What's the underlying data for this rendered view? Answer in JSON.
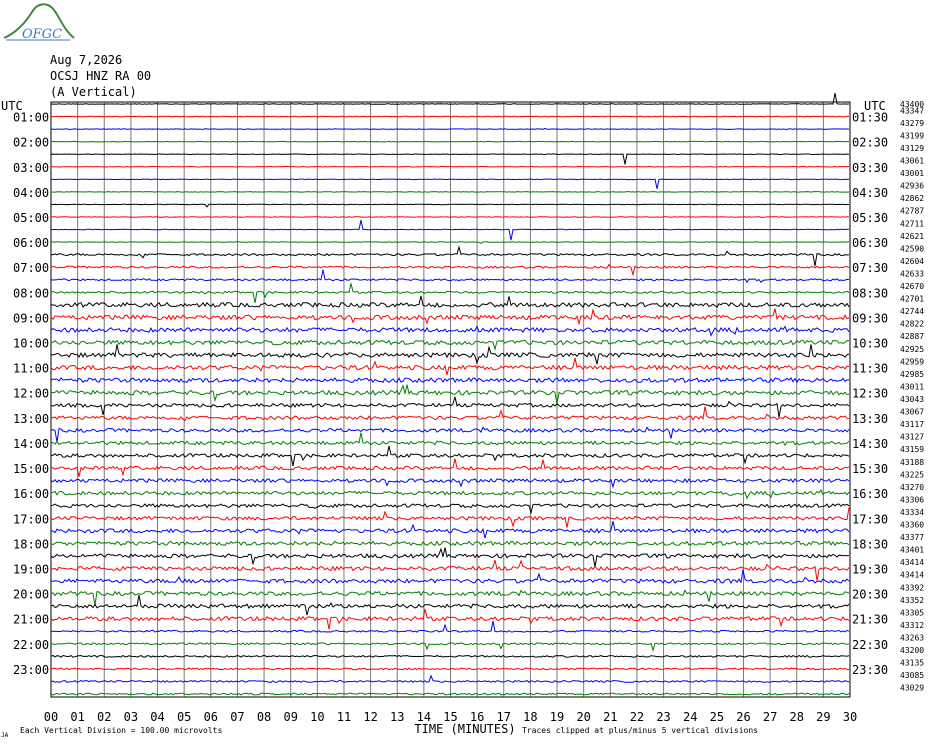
{
  "header": {
    "logo_text": "OFGC",
    "date": "Aug 7,2026",
    "station": "OCSJ HNZ RA 00",
    "component": "(A Vertical)"
  },
  "chart_data": {
    "type": "line",
    "title": "",
    "left_axis_label": "UTC",
    "right_axis_label": "UTC",
    "xlabel": "TIME (MINUTES)",
    "xlim": [
      0,
      30
    ],
    "x_ticks": [
      "00",
      "01",
      "02",
      "03",
      "04",
      "05",
      "06",
      "07",
      "08",
      "09",
      "10",
      "11",
      "12",
      "13",
      "14",
      "15",
      "16",
      "17",
      "18",
      "19",
      "20",
      "21",
      "22",
      "23",
      "24",
      "25",
      "26",
      "27",
      "28",
      "29",
      "30"
    ],
    "left_hour_labels": [
      "01:00",
      "02:00",
      "03:00",
      "04:00",
      "05:00",
      "06:00",
      "07:00",
      "08:00",
      "09:00",
      "10:00",
      "11:00",
      "12:00",
      "13:00",
      "14:00",
      "15:00",
      "16:00",
      "17:00",
      "18:00",
      "19:00",
      "20:00",
      "21:00",
      "22:00",
      "23:00"
    ],
    "right_hour_labels": [
      "01:30",
      "02:30",
      "03:30",
      "04:30",
      "05:30",
      "06:30",
      "07:30",
      "08:30",
      "09:30",
      "10:30",
      "11:30",
      "12:30",
      "13:30",
      "14:30",
      "15:30",
      "16:30",
      "17:30",
      "18:30",
      "19:30",
      "20:30",
      "21:30",
      "22:30",
      "23:30"
    ],
    "right_top_label": "43400",
    "trace_counts": [
      "43347",
      "43279",
      "43199",
      "43129",
      "43061",
      "43001",
      "42936",
      "42862",
      "42787",
      "42711",
      "42621",
      "42590",
      "42604",
      "42633",
      "42670",
      "42701",
      "42744",
      "42822",
      "42887",
      "42925",
      "42959",
      "42985",
      "43011",
      "43043",
      "43067",
      "43117",
      "43127",
      "43159",
      "43188",
      "43225",
      "43270",
      "43306",
      "43334",
      "43360",
      "43377",
      "43401",
      "43414",
      "43414",
      "43392",
      "43352",
      "43305",
      "43312",
      "43263",
      "43200",
      "43135",
      "43085",
      "43029"
    ],
    "trace_colors": [
      "#000000",
      "#ff0000",
      "#0000ff",
      "#008000"
    ],
    "grid": true,
    "footer_left": "Each Vertical Division =  100.00 microvolts",
    "footer_right": "Traces clipped at plus/minus 5 vertical divisions",
    "corner_mark": "JA"
  }
}
